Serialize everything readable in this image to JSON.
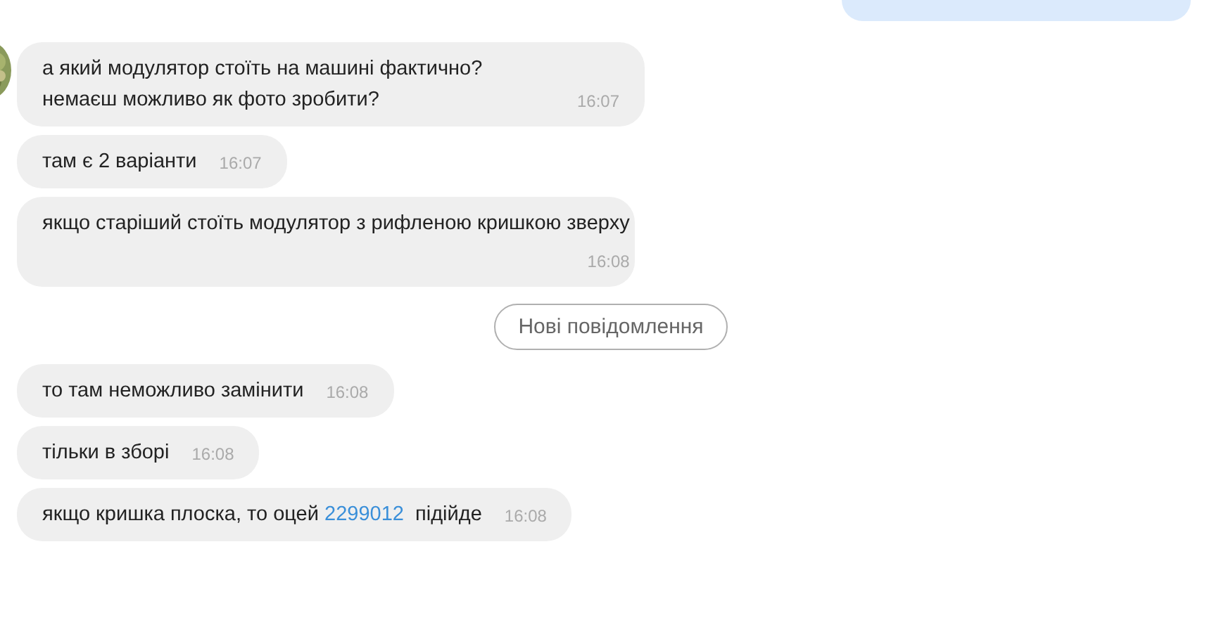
{
  "messages": [
    {
      "kind": "inline",
      "parts": [
        {
          "text": "а який модулятор стоїть на машині фактично? немаєш можливо як фото зробити?"
        }
      ],
      "time": "16:07"
    },
    {
      "kind": "inline",
      "parts": [
        {
          "text": "там є 2 варіанти"
        }
      ],
      "time": "16:07"
    },
    {
      "kind": "block",
      "parts": [
        {
          "text": "якщо старіший стоїть модулятор з рифленою кришкою зверху"
        }
      ],
      "time": "16:08"
    },
    {
      "kind": "divider",
      "label": "Нові повідомлення"
    },
    {
      "kind": "inline",
      "parts": [
        {
          "text": "то там неможливо замінити"
        }
      ],
      "time": "16:08"
    },
    {
      "kind": "inline",
      "parts": [
        {
          "text": "тільки в зборі"
        }
      ],
      "time": "16:08"
    },
    {
      "kind": "inline",
      "parts": [
        {
          "text": "якщо кришка плоска, то оцей "
        },
        {
          "text": "2299012",
          "kind": "link"
        },
        {
          "text": "  підійде"
        }
      ],
      "time": "16:08"
    }
  ]
}
